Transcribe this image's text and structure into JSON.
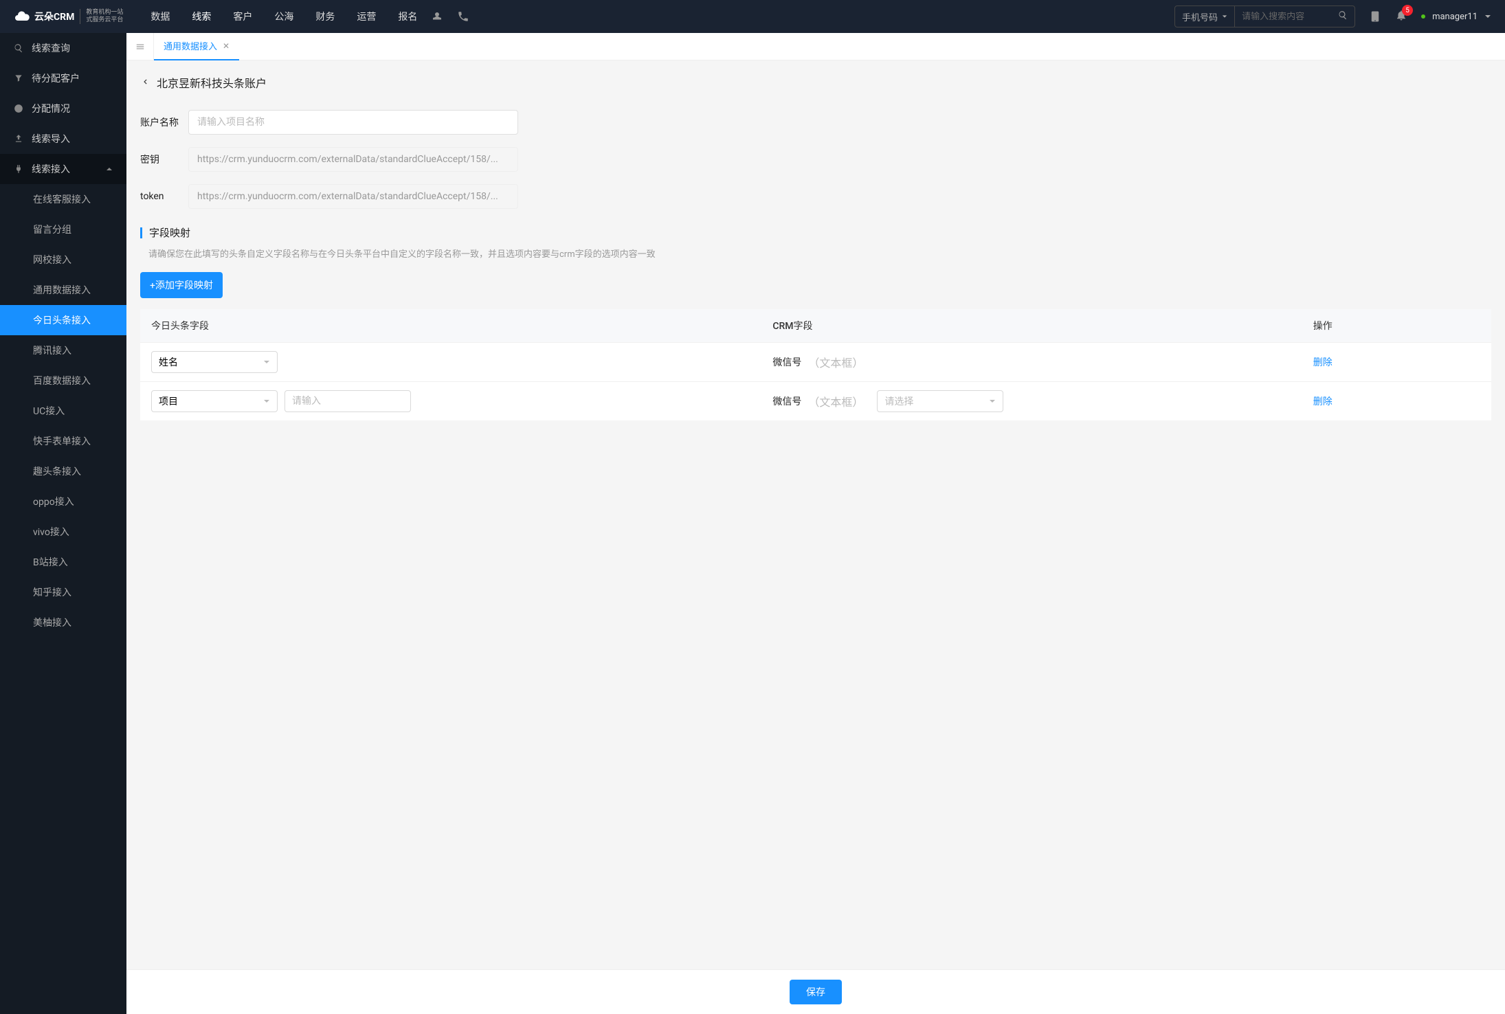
{
  "brand": {
    "name": "云朵CRM",
    "tagline1": "教育机构一站",
    "tagline2": "式服务云平台"
  },
  "nav": [
    "数据",
    "线索",
    "客户",
    "公海",
    "财务",
    "运营",
    "报名"
  ],
  "nav_active_index": 1,
  "search": {
    "type_label": "手机号码",
    "placeholder": "请输入搜索内容"
  },
  "notifications": {
    "count": "5"
  },
  "user": {
    "name": "manager11"
  },
  "sidebar": {
    "items": [
      {
        "label": "线索查询",
        "icon": "search"
      },
      {
        "label": "待分配客户",
        "icon": "filter"
      },
      {
        "label": "分配情况",
        "icon": "clock"
      },
      {
        "label": "线索导入",
        "icon": "import"
      },
      {
        "label": "线索接入",
        "icon": "plug",
        "expanded": true,
        "children": [
          {
            "label": "在线客服接入"
          },
          {
            "label": "留言分组"
          },
          {
            "label": "网校接入"
          },
          {
            "label": "通用数据接入"
          },
          {
            "label": "今日头条接入",
            "active": true
          },
          {
            "label": "腾讯接入"
          },
          {
            "label": "百度数据接入"
          },
          {
            "label": "UC接入"
          },
          {
            "label": "快手表单接入"
          },
          {
            "label": "趣头条接入"
          },
          {
            "label": "oppo接入"
          },
          {
            "label": "vivo接入"
          },
          {
            "label": "B站接入"
          },
          {
            "label": "知乎接入"
          },
          {
            "label": "美柚接入"
          }
        ]
      }
    ]
  },
  "tabs": [
    {
      "label": "通用数据接入",
      "closable": true
    }
  ],
  "page": {
    "title": "北京昱新科技头条账户",
    "form": {
      "account_label": "账户名称",
      "account_placeholder": "请输入项目名称",
      "secret_label": "密钥",
      "secret_value": "https://crm.yunduocrm.com/externalData/standardClueAccept/158/...",
      "token_label": "token",
      "token_value": "https://crm.yunduocrm.com/externalData/standardClueAccept/158/..."
    },
    "mapping": {
      "title": "字段映射",
      "desc": "请确保您在此填写的头条自定义字段名称与在今日头条平台中自定义的字段名称一致，并且选项内容要与crm字段的选项内容一致",
      "add_btn": "+添加字段映射",
      "columns": {
        "c1": "今日头条字段",
        "c2": "CRM字段",
        "c3": "操作"
      },
      "rows": [
        {
          "toutiao_value": "姓名",
          "crm_label": "微信号",
          "crm_hint": "（文本框）",
          "delete": "删除",
          "has_extra_input": false,
          "has_crm_select": false
        },
        {
          "toutiao_value": "项目",
          "extra_input_placeholder": "请输入",
          "crm_label": "微信号",
          "crm_hint": "（文本框）",
          "crm_select_placeholder": "请选择",
          "delete": "删除",
          "has_extra_input": true,
          "has_crm_select": true
        }
      ]
    },
    "save": "保存"
  }
}
